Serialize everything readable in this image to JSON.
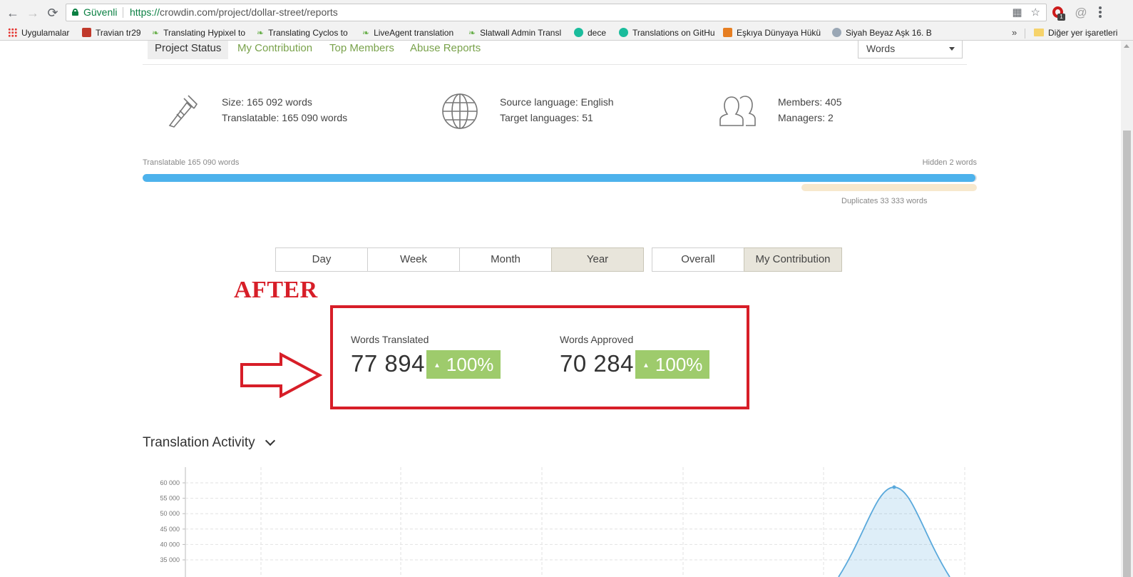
{
  "browser": {
    "secure_label": "Güvenli",
    "url_scheme": "https://",
    "url_rest": "crowdin.com/project/dollar-street/reports",
    "extension_badge": "1",
    "bookmarks": [
      {
        "label": "Uygulamalar",
        "icon": "apps-grid-icon"
      },
      {
        "label": "Travian tr29",
        "icon": "travian-icon"
      },
      {
        "label": "Translating Hypixel to",
        "icon": "crowdin-leaf-icon"
      },
      {
        "label": "Translating Cyclos to",
        "icon": "crowdin-leaf-icon"
      },
      {
        "label": "LiveAgent translation",
        "icon": "crowdin-leaf-icon"
      },
      {
        "label": "Slatwall Admin Transl",
        "icon": "crowdin-leaf-icon"
      },
      {
        "label": "dece",
        "icon": "globe-teal-icon"
      },
      {
        "label": "Translations on GitHu",
        "icon": "globe-teal-icon"
      },
      {
        "label": "Eşkıya Dünyaya Hükü",
        "icon": "game-icon"
      },
      {
        "label": "Siyah Beyaz Aşk 16. B",
        "icon": "disc-icon"
      }
    ],
    "bookmarks_more": "»",
    "other_bookmarks": "Diğer yer işaretleri"
  },
  "tabs": [
    {
      "label": "Project Status",
      "active": true
    },
    {
      "label": "My Contribution",
      "active": false
    },
    {
      "label": "Top Members",
      "active": false
    },
    {
      "label": "Abuse Reports",
      "active": false
    }
  ],
  "units_select": {
    "value": "Words"
  },
  "stats": {
    "size": "Size: 165 092 words",
    "translatable": "Translatable: 165 090 words",
    "source_language": "Source language: English",
    "target_languages": "Target languages: 51",
    "members": "Members: 405",
    "managers": "Managers: 2"
  },
  "progress": {
    "translatable_label": "Translatable 165 090 words",
    "hidden_label": "Hidden 2 words",
    "duplicates_label": "Duplicates 33 333 words",
    "translated_fraction": 0.9987
  },
  "period_buttons": [
    {
      "label": "Day",
      "active": false
    },
    {
      "label": "Week",
      "active": false
    },
    {
      "label": "Month",
      "active": false
    },
    {
      "label": "Year",
      "active": true
    }
  ],
  "scope_buttons": [
    {
      "label": "Overall",
      "active": false
    },
    {
      "label": "My Contribution",
      "active": true
    }
  ],
  "annotation": {
    "label": "AFTER",
    "color": "#d71e28"
  },
  "metrics": {
    "translated": {
      "label": "Words Translated",
      "value": "77 894",
      "change": "100%"
    },
    "approved": {
      "label": "Words Approved",
      "value": "70 284",
      "change": "100%"
    }
  },
  "activity": {
    "title": "Translation Activity"
  },
  "chart_data": {
    "type": "area",
    "y_ticks": [
      "60 000",
      "55 000",
      "50 000",
      "45 000",
      "40 000",
      "35 000"
    ],
    "ylim": [
      32000,
      62000
    ],
    "peak_value": 58600,
    "color": "#5aa9dc",
    "grid": true
  }
}
